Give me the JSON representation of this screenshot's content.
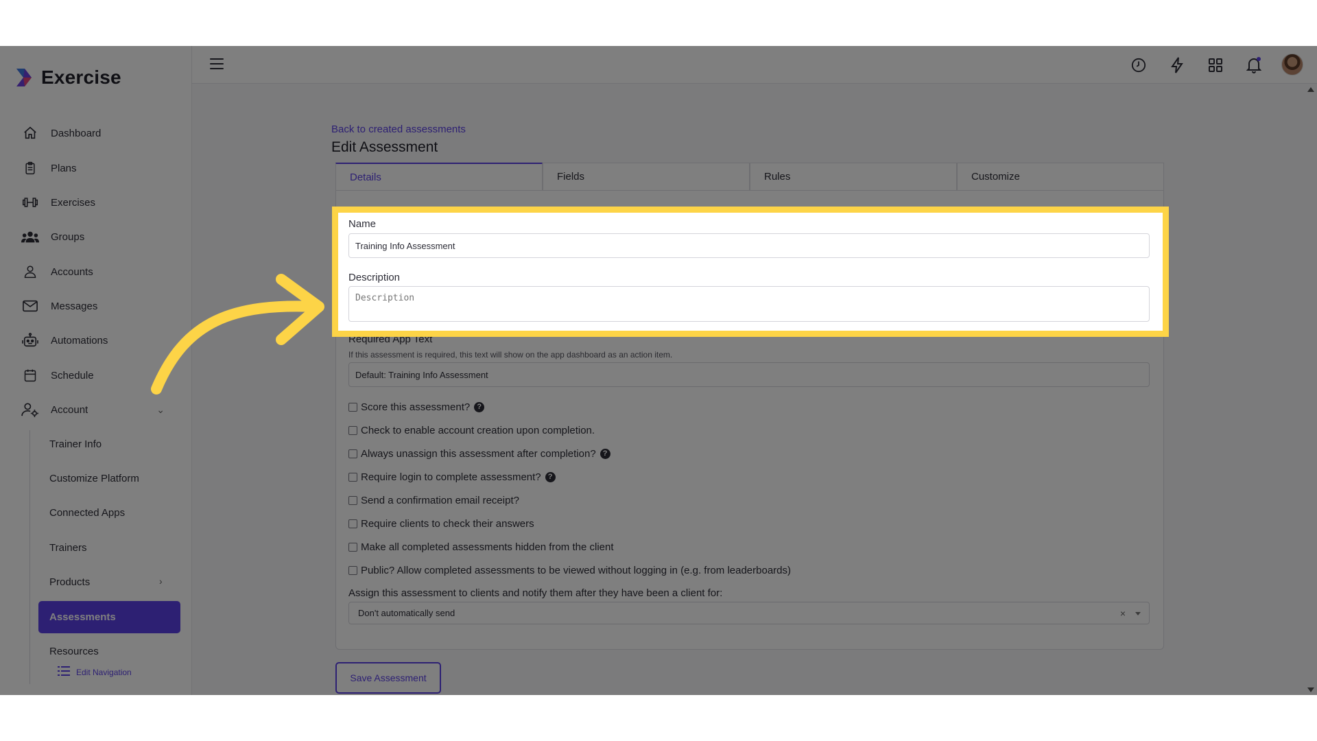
{
  "app": {
    "brand": "Exercise"
  },
  "sidebar": {
    "items": [
      {
        "label": "Dashboard",
        "icon": "home-icon"
      },
      {
        "label": "Plans",
        "icon": "clipboard-icon"
      },
      {
        "label": "Exercises",
        "icon": "dumbbell-icon"
      },
      {
        "label": "Groups",
        "icon": "users-icon"
      },
      {
        "label": "Accounts",
        "icon": "user-icon"
      },
      {
        "label": "Messages",
        "icon": "envelope-icon"
      },
      {
        "label": "Automations",
        "icon": "robot-icon"
      },
      {
        "label": "Schedule",
        "icon": "calendar-icon"
      },
      {
        "label": "Account",
        "icon": "user-gear-icon"
      }
    ],
    "subitems": [
      "Trainer Info",
      "Customize Platform",
      "Connected Apps",
      "Trainers",
      "Products",
      "Assessments",
      "Resources"
    ],
    "edit_nav": "Edit Navigation"
  },
  "main": {
    "back_link": "Back to created assessments",
    "title": "Edit Assessment",
    "tabs": [
      "Details",
      "Fields",
      "Rules",
      "Customize"
    ],
    "name_label": "Name",
    "name_value": "Training Info Assessment",
    "description_label": "Description",
    "description_placeholder": "Description",
    "required_label": "Required App Text",
    "required_help": "If this assessment is required, this text will show on the app dashboard as an action item.",
    "required_value": "Default: Training Info Assessment",
    "checks": [
      {
        "label": "Score this assessment?",
        "help": true
      },
      {
        "label": "Check to enable account creation upon completion.",
        "help": false
      },
      {
        "label": "Always unassign this assessment after completion?",
        "help": true
      },
      {
        "label": "Require login to complete assessment?",
        "help": true
      },
      {
        "label": "Send a confirmation email receipt?",
        "help": false
      },
      {
        "label": "Require clients to check their answers",
        "help": false
      },
      {
        "label": "Make all completed assessments hidden from the client",
        "help": false
      },
      {
        "label": "Public? Allow completed assessments to be viewed without logging in (e.g. from leaderboards)",
        "help": false
      }
    ],
    "assign_label": "Assign this assessment to clients and notify them after they have been a client for:",
    "assign_value": "Don't automatically send",
    "clear_glyph": "×",
    "help_glyph": "?",
    "save_label": "Save Assessment"
  },
  "colors": {
    "accent": "#5b40e6",
    "highlight": "#fdd447"
  }
}
